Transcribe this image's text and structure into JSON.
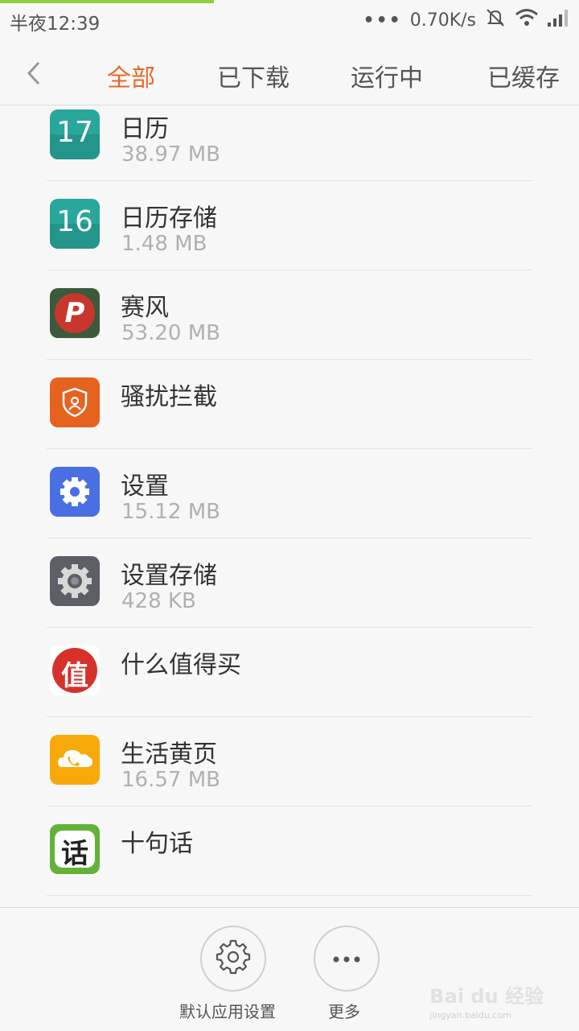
{
  "status": {
    "time": "半夜12:39",
    "dots": "•••",
    "network_speed": "0.70K/s"
  },
  "tabs": [
    "全部",
    "已下载",
    "运行中",
    "已缓存"
  ],
  "active_tab": "全部",
  "apps": [
    {
      "name": "日历",
      "size": "38.97 MB",
      "icon": "calendar-17-icon"
    },
    {
      "name": "日历存储",
      "size": "1.48 MB",
      "icon": "calendar-16-icon"
    },
    {
      "name": "赛风",
      "size": "53.20 MB",
      "icon": "psiphon-icon"
    },
    {
      "name": "骚扰拦截",
      "size": "",
      "icon": "shield-icon"
    },
    {
      "name": "设置",
      "size": "15.12 MB",
      "icon": "settings-gear-icon"
    },
    {
      "name": "设置存储",
      "size": "428 KB",
      "icon": "settings-storage-gear-icon"
    },
    {
      "name": "什么值得买",
      "size": "",
      "icon": "smzdm-icon"
    },
    {
      "name": "生活黄页",
      "size": "16.57 MB",
      "icon": "yellow-pages-icon"
    },
    {
      "name": "十句话",
      "size": "",
      "icon": "shijuhua-icon"
    }
  ],
  "calendar_icons": {
    "cal1": "17",
    "cal2": "16"
  },
  "psiphon_letter": "P",
  "smzdm_char": "值",
  "shijuhua_char": "话",
  "bottom": {
    "default_apps_label": "默认应用设置",
    "more_label": "更多"
  },
  "watermark": {
    "brand": "Bai du 经验",
    "url": "jingyan.baidu.com"
  },
  "colors": {
    "accent": "#e8692a",
    "calendar": "#2aa79c",
    "psiphon": "#c8372d",
    "shield": "#e5621f",
    "settings": "#4a6fe3",
    "settings_storage": "#5c5f66",
    "yellow_pages": "#f8a90a",
    "shijuhua": "#62b23a"
  }
}
